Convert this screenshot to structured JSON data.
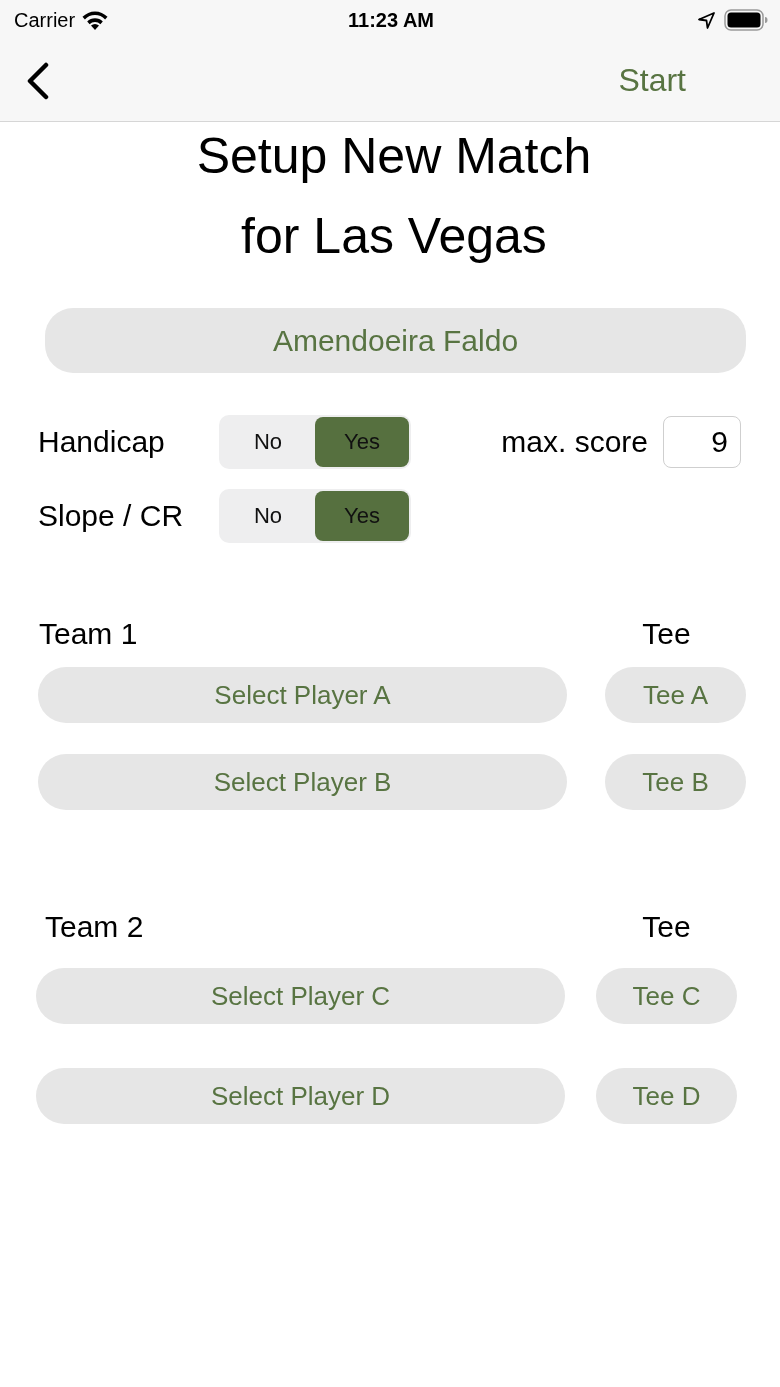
{
  "status_bar": {
    "carrier": "Carrier",
    "time": "11:23 AM"
  },
  "nav": {
    "action": "Start"
  },
  "title": [
    "Setup New Match",
    "for Las Vegas"
  ],
  "course": {
    "label": "Amendoeira Faldo"
  },
  "options": [
    {
      "label": "Handicap",
      "segments": [
        {
          "label": "No",
          "selected": false
        },
        {
          "label": "Yes",
          "selected": true
        }
      ]
    },
    {
      "label": "Slope / CR",
      "segments": [
        {
          "label": "No",
          "selected": false
        },
        {
          "label": "Yes",
          "selected": true
        }
      ]
    }
  ],
  "max_score": {
    "label": "max. score",
    "value": "9"
  },
  "teams": [
    {
      "label": "Team 1",
      "tee_label": "Tee",
      "players": [
        {
          "label": "Select Player A",
          "tee": "Tee A"
        },
        {
          "label": "Select Player B",
          "tee": "Tee B"
        }
      ]
    },
    {
      "label": "Team 2",
      "tee_label": "Tee",
      "players": [
        {
          "label": "Select Player C",
          "tee": "Tee C"
        },
        {
          "label": "Select Player D",
          "tee": "Tee D"
        }
      ]
    }
  ]
}
